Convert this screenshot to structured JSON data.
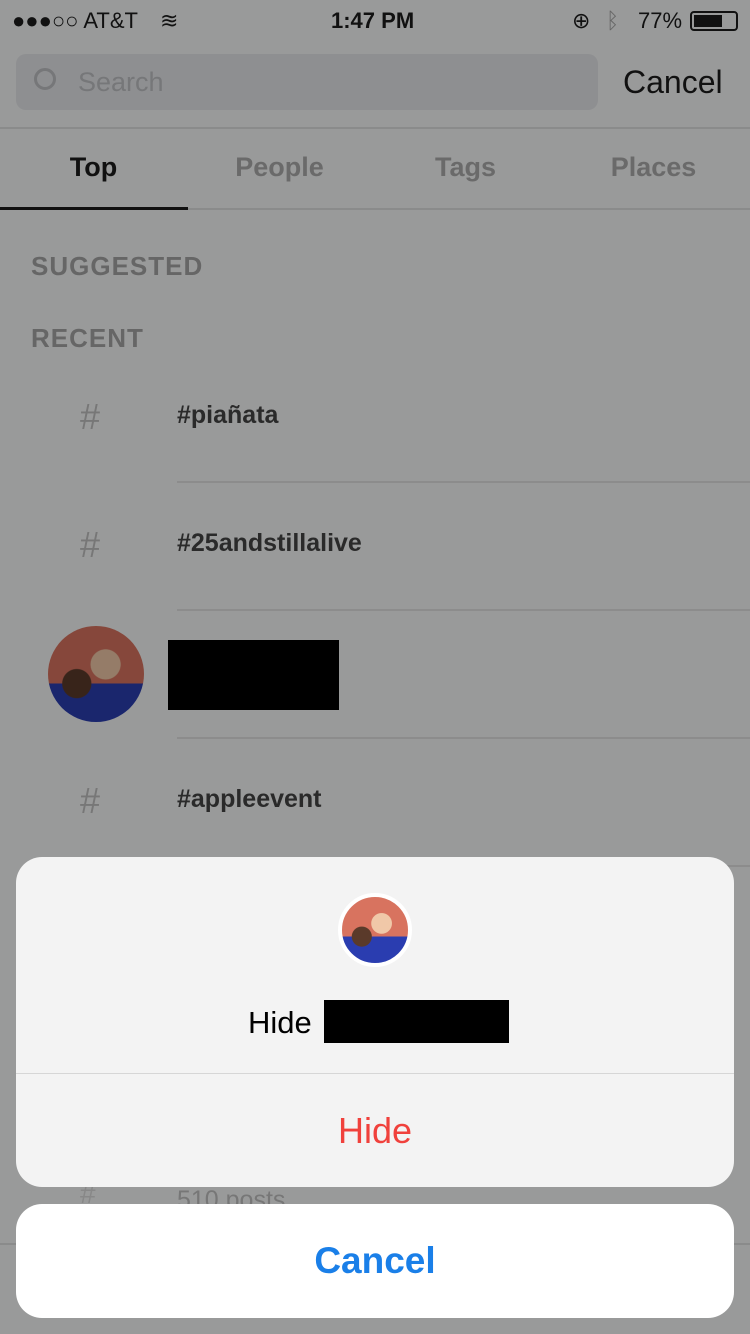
{
  "status": {
    "carrier": "●●●○○ AT&T",
    "time": "1:47 PM",
    "battery": "77%"
  },
  "search": {
    "placeholder": "Search",
    "cancel": "Cancel"
  },
  "tabs": [
    {
      "label": "Top",
      "active": true
    },
    {
      "label": "People"
    },
    {
      "label": "Tags"
    },
    {
      "label": "Places"
    }
  ],
  "sections": {
    "suggested": "SUGGESTED",
    "recent": "RECENT"
  },
  "recent": [
    {
      "icon": "hashtag-icon",
      "label": "#piañata"
    },
    {
      "icon": "hashtag-icon",
      "label": "#25andstillalive"
    },
    {
      "icon": "avatar",
      "label": ""
    },
    {
      "icon": "hashtag-icon",
      "label": "#appleevent"
    }
  ],
  "partial_row": {
    "subtitle": "510 posts"
  },
  "action_sheet": {
    "title_prefix": "Hide",
    "hide": "Hide",
    "cancel": "Cancel",
    "destructive_color": "#f0413c",
    "accent_color": "#1a7fe8"
  }
}
